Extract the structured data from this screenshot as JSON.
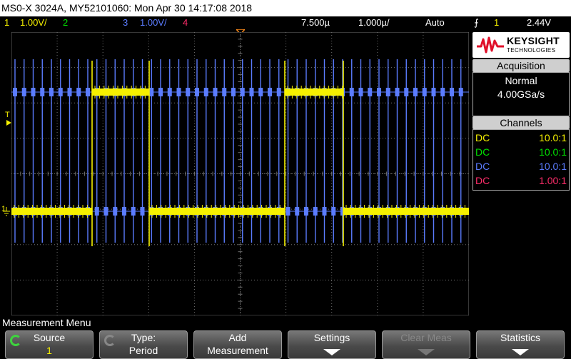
{
  "title": "MS0-X 3024A, MY52101060: Mon Apr 30 14:17:08 2018",
  "status": {
    "ch1_num": "1",
    "ch1_scale": "1.00V/",
    "ch2_num": "2",
    "ch3_num": "3",
    "ch3_scale": "1.00V/",
    "ch4_num": "4",
    "time_offset": "7.500µ",
    "timebase": "1.000µ/",
    "trigger_mode": "Auto",
    "trigger_icon": "rising-edge-icon",
    "trigger_channel": "1",
    "trigger_level": "2.44V"
  },
  "colors": {
    "ch1": "#f5f000",
    "ch2": "#00e000",
    "ch3": "#5b7cff",
    "ch4": "#ff2d6a",
    "grid": "#6e6e6e"
  },
  "logo": {
    "brand": "KEYSIGHT",
    "sub": "TECHNOLOGIES"
  },
  "acquisition": {
    "header": "Acquisition",
    "mode": "Normal",
    "rate": "4.00GSa/s"
  },
  "channels": {
    "header": "Channels",
    "rows": [
      {
        "coupling": "DC",
        "probe": "10.0:1"
      },
      {
        "coupling": "DC",
        "probe": "10.0:1"
      },
      {
        "coupling": "DC",
        "probe": "10.0:1"
      },
      {
        "coupling": "DC",
        "probe": "1.00:1"
      }
    ]
  },
  "markers": {
    "trigger_level": "T",
    "ground_ch1": "1"
  },
  "menu": {
    "title": "Measurement Menu",
    "softkeys": [
      {
        "line1": "Source",
        "line2": "1",
        "icon": "rotary-knob-icon"
      },
      {
        "line1": "Type:",
        "line2": "Period",
        "icon": "rotary-knob-icon"
      },
      {
        "line1": "Add",
        "line2": "Measurement"
      },
      {
        "line1": "Settings",
        "icon": "down-arrow-icon"
      },
      {
        "line1": "Clear Meas",
        "icon": "down-arrow-icon",
        "disabled": true
      },
      {
        "line1": "Statistics",
        "icon": "down-arrow-icon"
      }
    ]
  }
}
